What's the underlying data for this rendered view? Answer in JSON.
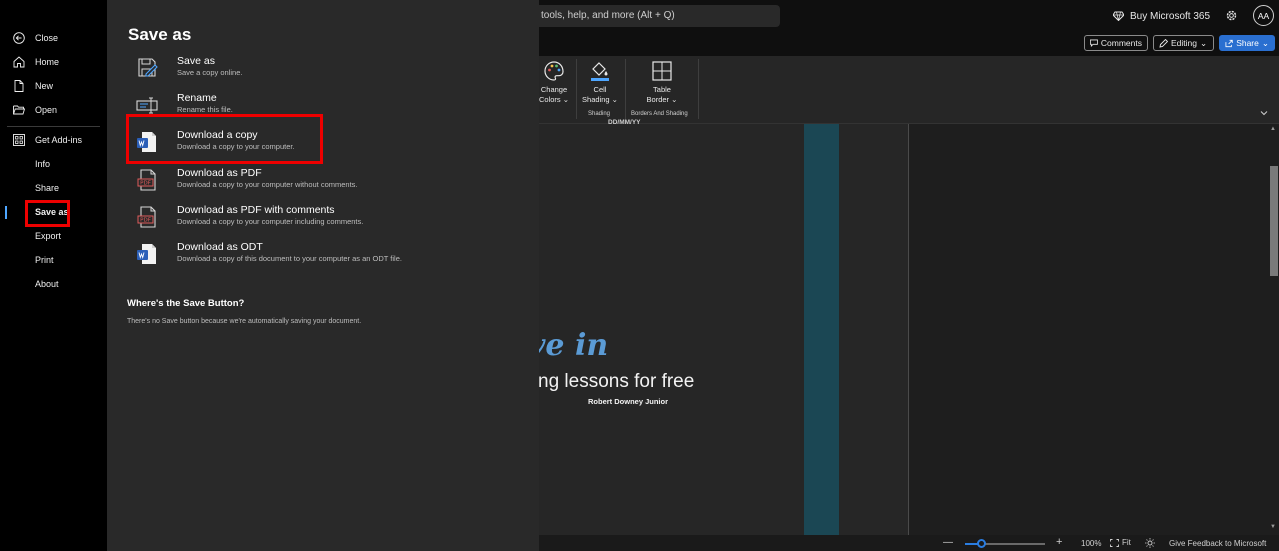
{
  "app": {
    "search_text": "tools, help, and more (Alt + Q)",
    "buy_label": "Buy Microsoft 365",
    "avatar_initials": "AA",
    "comments_label": "Comments",
    "editing_label": "Editing",
    "share_label": "Share",
    "accent_color": "#2a6fd0"
  },
  "ribbon": {
    "buttons": [
      {
        "line1": "Change",
        "line2": "Colors ⌄",
        "icon": "palette-icon"
      },
      {
        "line1": "Cell",
        "line2": "Shading ⌄",
        "icon": "paint-bucket-icon"
      },
      {
        "line1": "Table",
        "line2": "Border ⌄",
        "icon": "table-border-icon"
      }
    ],
    "groups": [
      "Shading",
      "Borders And Shading"
    ]
  },
  "document": {
    "date_text": "DD/MM/YY",
    "script_text": "ve in",
    "lessons_text": "ng lessons for free",
    "author": "Robert Downey Junior"
  },
  "statusbar": {
    "zoom_level": "100%",
    "zoom_fraction": 0.2,
    "fit_label": "Fit",
    "feedback_label": "Give Feedback to Microsoft"
  },
  "nav": {
    "items": [
      {
        "label": "Close",
        "icon": "back-arrow-icon"
      },
      {
        "label": "Home",
        "icon": "home-icon"
      },
      {
        "label": "New",
        "icon": "new-doc-icon"
      },
      {
        "label": "Open",
        "icon": "folder-icon"
      },
      {
        "label": "Get Add-ins",
        "icon": "add-ins-icon"
      },
      {
        "label": "Info"
      },
      {
        "label": "Share"
      },
      {
        "label": "Save as",
        "active": true
      },
      {
        "label": "Export"
      },
      {
        "label": "Print"
      },
      {
        "label": "About"
      }
    ]
  },
  "panel": {
    "title": "Save as",
    "options": [
      {
        "title": "Save as",
        "desc": "Save a copy online.",
        "icon": "save-as-icon"
      },
      {
        "title": "Rename",
        "desc": "Rename this file.",
        "icon": "rename-icon"
      },
      {
        "title": "Download a copy",
        "desc": "Download a copy to your computer.",
        "icon": "word-doc-icon"
      },
      {
        "title": "Download as PDF",
        "desc": "Download a copy to your computer without comments.",
        "icon": "pdf-icon"
      },
      {
        "title": "Download as PDF with comments",
        "desc": "Download a copy to your computer including comments.",
        "icon": "pdf-icon"
      },
      {
        "title": "Download as ODT",
        "desc": "Download a copy of this document to your computer as an ODT file.",
        "icon": "word-doc-icon"
      }
    ],
    "hint_title": "Where's the Save Button?",
    "hint_desc": "There's no Save button because we're automatically saving your document."
  },
  "highlight_color": "#e00000"
}
